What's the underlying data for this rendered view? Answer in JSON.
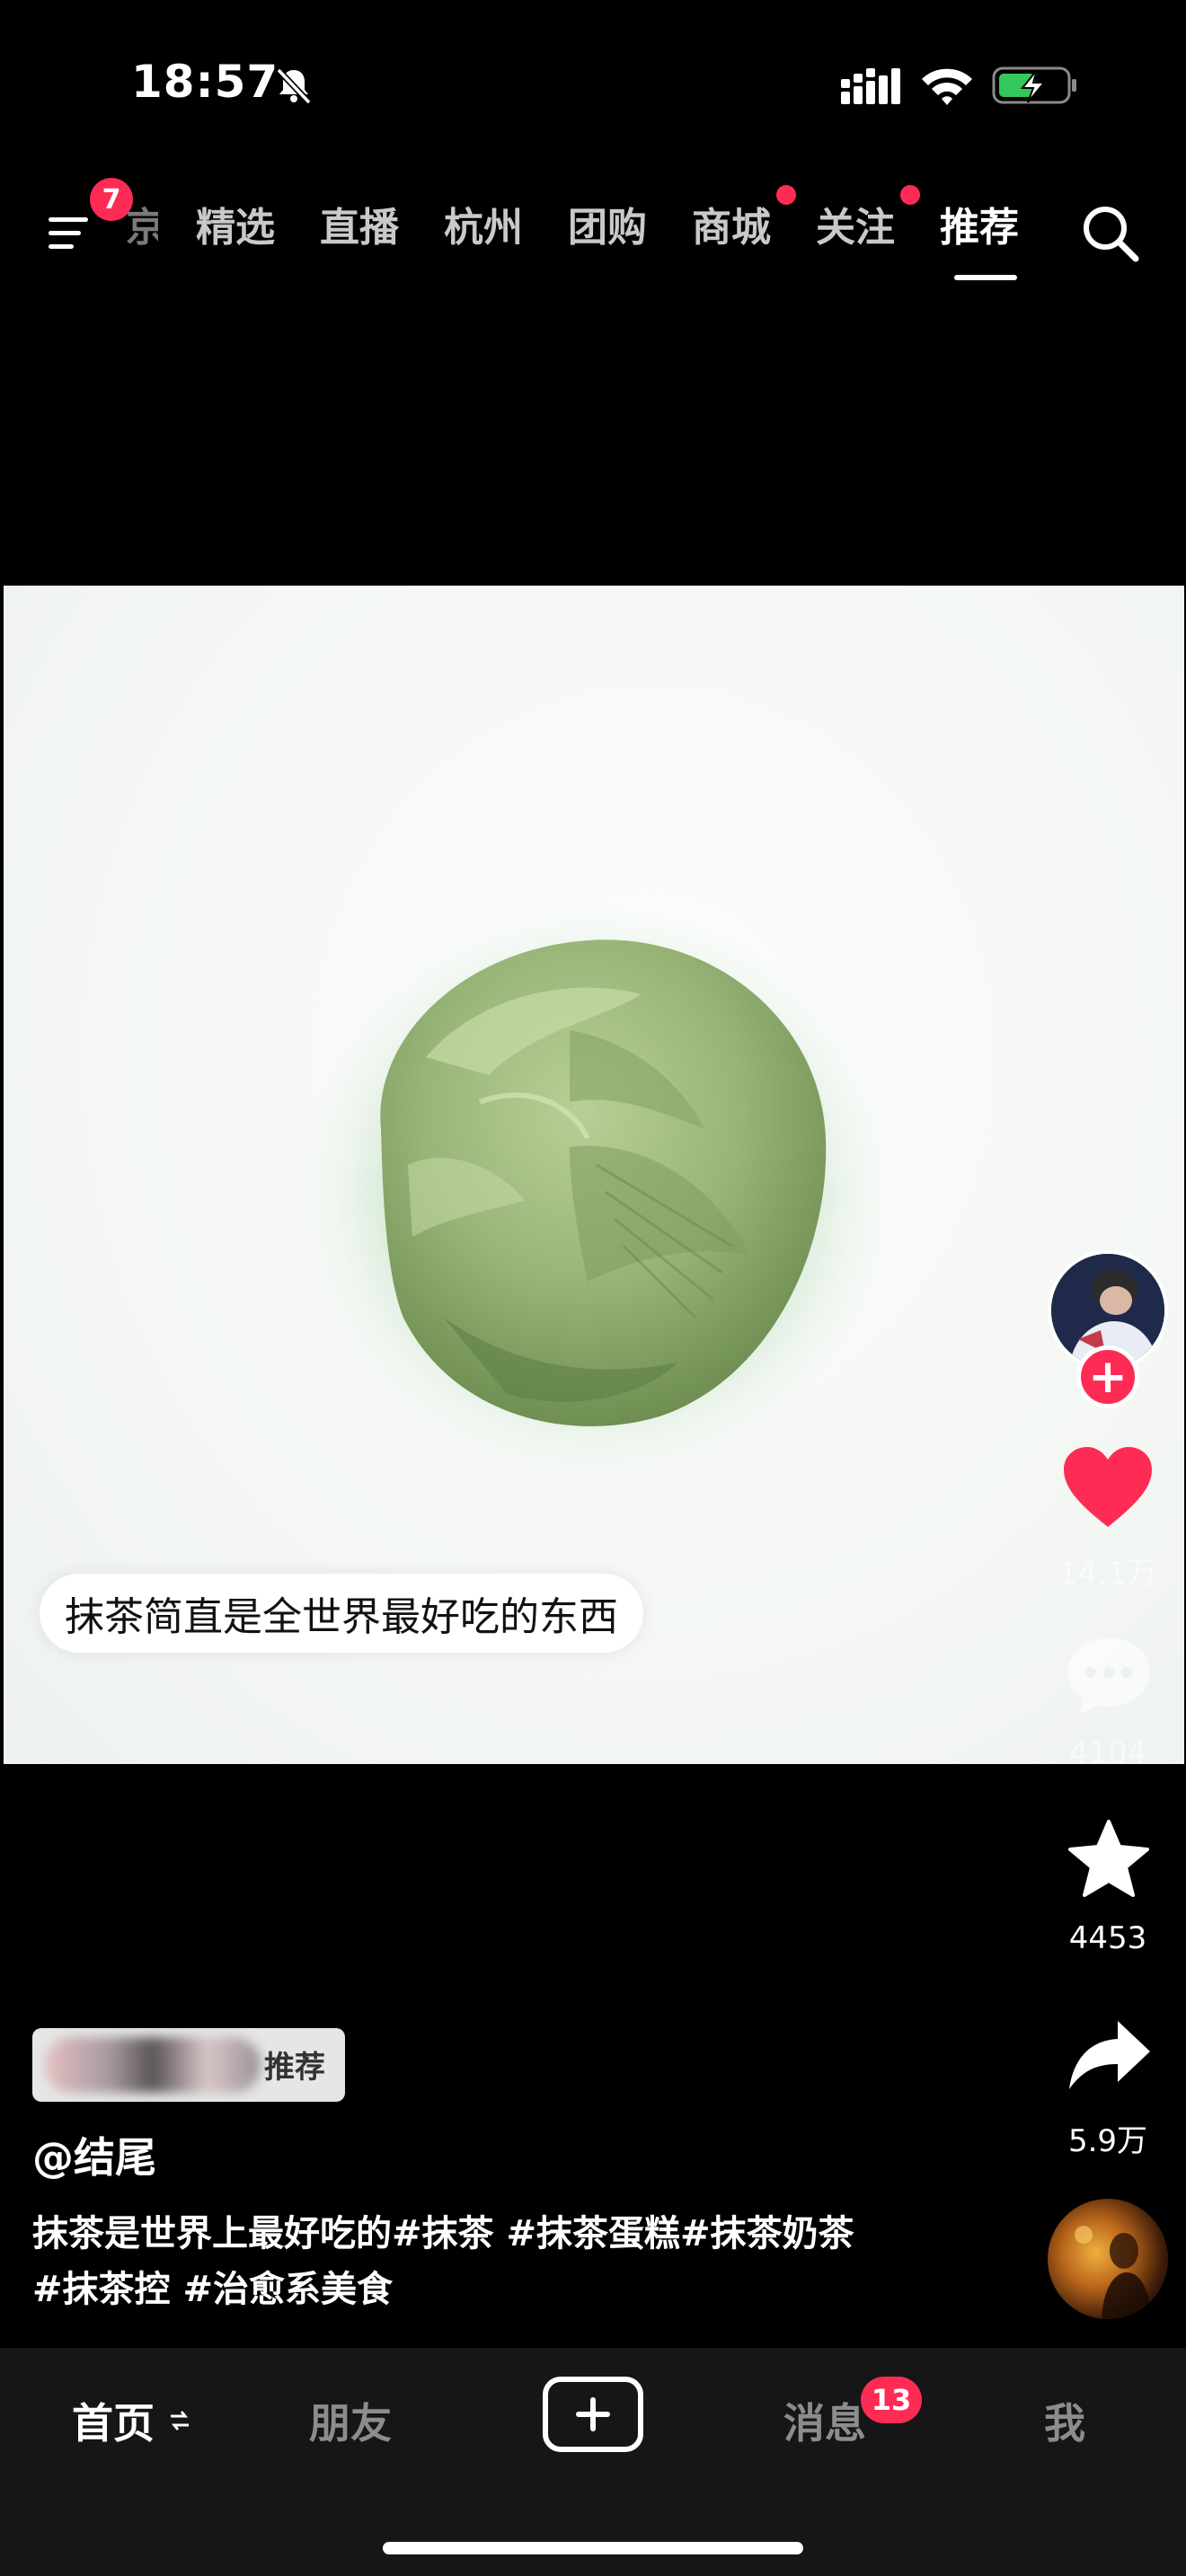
{
  "status_bar": {
    "time": "18:57",
    "battery_state": "charging"
  },
  "top_nav": {
    "menu_badge": "7",
    "tabs": [
      {
        "label": "京",
        "partial": true
      },
      {
        "label": "精选"
      },
      {
        "label": "直播"
      },
      {
        "label": "杭州"
      },
      {
        "label": "团购"
      },
      {
        "label": "商城",
        "dot": true
      },
      {
        "label": "关注",
        "dot": true
      },
      {
        "label": "推荐",
        "active": true
      }
    ]
  },
  "video": {
    "caption": "抹茶简直是全世界最好吃的东西",
    "subject": "matcha ice cream scoop"
  },
  "right_rail": {
    "like_count": "14.1万",
    "comment_count": "4104",
    "favorite_count": "4453",
    "share_count": "5.9万"
  },
  "post": {
    "tag_label": "推荐",
    "author": "@结尾",
    "description_line1": "抹茶是世界上最好吃的#抹茶 #抹茶蛋糕#抹茶奶茶",
    "description_line2": "#抹茶控 #治愈系美食"
  },
  "bottom_nav": {
    "home": "首页",
    "friends": "朋友",
    "messages": "消息",
    "messages_badge": "13",
    "me": "我"
  },
  "colors": {
    "accent": "#fe2c55",
    "background": "#000000",
    "bottom_bar": "#161616"
  }
}
